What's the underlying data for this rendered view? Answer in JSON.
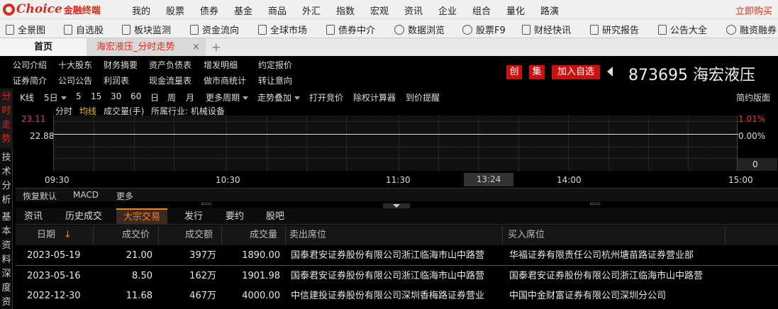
{
  "menubar": {
    "brand": "Choice",
    "brand_cn": "金融终端",
    "items": [
      "我的",
      "股票",
      "债券",
      "基金",
      "商品",
      "外汇",
      "指数",
      "宏观",
      "资讯",
      "企业",
      "组合",
      "量化",
      "路演"
    ],
    "buy_now": "立即购买"
  },
  "toolbar": {
    "items": [
      "全景图",
      "自选股",
      "板块监测",
      "资金流向",
      "全球市场",
      "债券中介",
      "数据浏览",
      "股票F9",
      "财经快讯",
      "研究报告",
      "公告大全",
      "融资融券"
    ]
  },
  "tabs": {
    "home": "首页",
    "stock": "海宏液压_分时走势",
    "close": "×",
    "add": "+"
  },
  "f10": {
    "row1": [
      "公司介绍",
      "十大股东",
      "财务摘要",
      "资产负债表",
      "增发明细",
      "约定报价"
    ],
    "row2": [
      "证券简介",
      "公司公告",
      "利润表",
      "现金流量表",
      "做市商统计",
      "转让意向"
    ]
  },
  "stock": {
    "btn_chuang": "创",
    "btn_ji": "集",
    "btn_add": "加入自选",
    "code": "873695",
    "name": "海宏液压"
  },
  "left_tabs": [
    {
      "label": "分时走势",
      "active": true
    },
    {
      "label": "技术分析",
      "active": false
    },
    {
      "label": "基本资料",
      "active": false
    },
    {
      "label": "深度资",
      "active": false
    }
  ],
  "chart_toolbar": {
    "kline": "K线",
    "period": "5日",
    "periods": [
      "5",
      "15",
      "30",
      "60",
      "日",
      "周",
      "月"
    ],
    "more_periods": "更多周期",
    "overlay": "走势叠加",
    "open_auction": "打开竞价",
    "calculator": "除权计算器",
    "price_alert": "到价提醒",
    "simple": "简约版面"
  },
  "chart_sub": {
    "fenshi": "分时",
    "avg": "均线",
    "volume": "成交量(手)",
    "industry": "所属行业: 机械设备"
  },
  "chart_data": {
    "type": "line",
    "y_left": {
      "top": "23.11",
      "mid": "22.88"
    },
    "y_right": {
      "top": "1.01%",
      "mid": "0.00%"
    },
    "x_ticks": [
      "09:30",
      "10:30",
      "11:30",
      "13:24",
      "14:00",
      "15:00"
    ],
    "current_time": "13:24",
    "price_series": [
      22.88,
      22.88
    ],
    "volume_value": "0",
    "colors": {
      "up": "#ff3333",
      "flat": "#dddddd"
    }
  },
  "indicator_bar": [
    "恢复默认",
    "MACD",
    "更多"
  ],
  "lower_tabs": [
    {
      "label": "资讯",
      "active": false
    },
    {
      "label": "历史成交",
      "active": false
    },
    {
      "label": "大宗交易",
      "active": true
    },
    {
      "label": "发行",
      "active": false
    },
    {
      "label": "要约",
      "active": false
    },
    {
      "label": "股吧",
      "active": false
    }
  ],
  "table": {
    "headers": {
      "date": "日期",
      "sort": "↓",
      "price": "成交价",
      "amount": "成交额",
      "volume": "成交量",
      "seller": "卖出席位",
      "buyer": "买入席位"
    },
    "rows": [
      {
        "date": "2023-05-19",
        "price": "21.00",
        "amount": "397万",
        "volume": "1890.00",
        "seller": "国泰君安证券股份有限公司浙江临海市山中路营",
        "buyer": "华福证券有限责任公司杭州塘苗路证券营业部"
      },
      {
        "date": "2023-05-16",
        "price": "8.50",
        "amount": "162万",
        "volume": "1901.98",
        "seller": "国泰君安证券股份有限公司浙江临海市山中路营",
        "buyer": "国泰君安证券股份有限公司浙江临海市山中路营"
      },
      {
        "date": "2022-12-30",
        "price": "11.68",
        "amount": "467万",
        "volume": "4000.00",
        "seller": "中信建投证券股份有限公司深圳香梅路证券营业",
        "buyer": "中国中金财富证券有限公司深圳分公司"
      }
    ]
  }
}
